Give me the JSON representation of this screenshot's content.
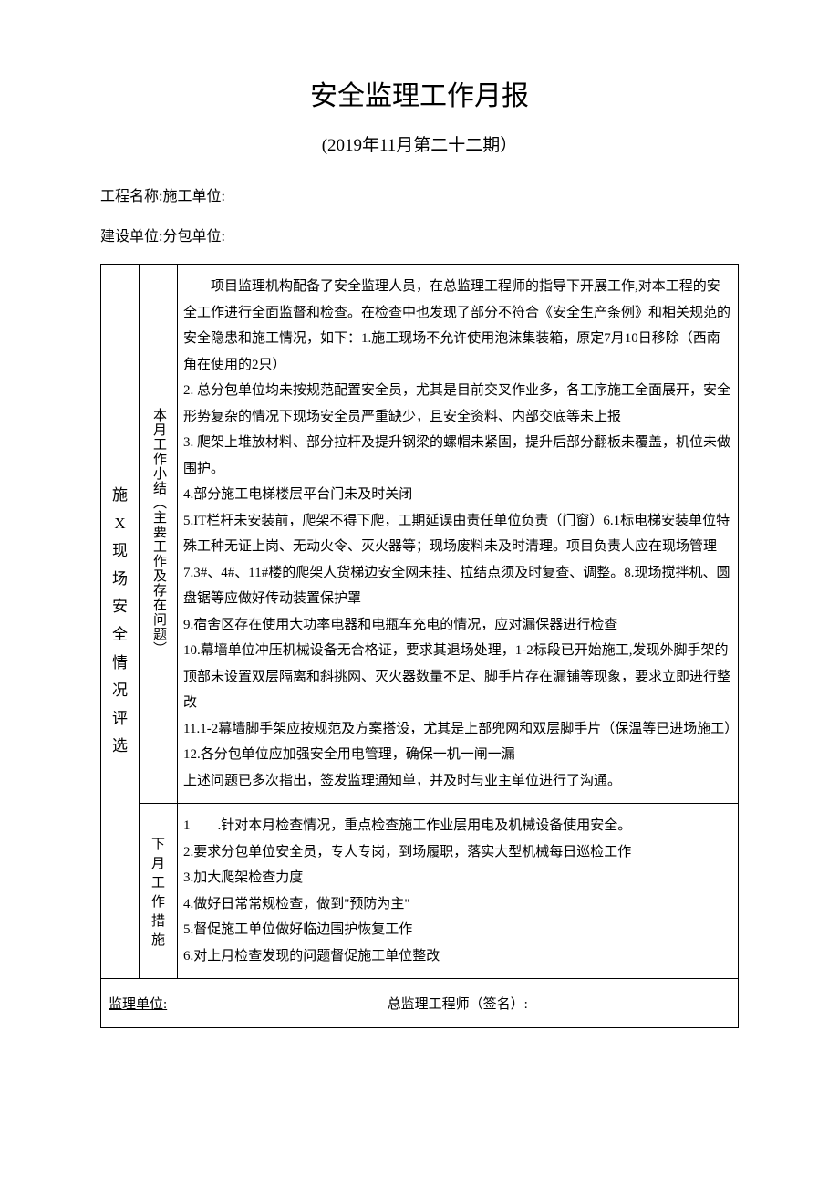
{
  "title": "安全监理工作月报",
  "subtitle": "(2019年11月第二十二期）",
  "meta": {
    "line1": "工程名称:施工单位:",
    "line2": "建设单位:分包单位:"
  },
  "rowLabel": "施X现 场安 全情 况评 选",
  "summary": {
    "label": "本月工作小结︵主要工作及存在问题︶",
    "intro": "项目监理机构配备了安全监理人员，在总监理工程师的指导下开展工作,对本工程的安全工作进行全面监督和检查。在检查中也发现了部分不符合《安全生产条例》和相关规范的安全隐患和施工情况，如下：1.施工现场不允许使用泡沫集装箱，原定7月10日移除（西南角在使用的2只）",
    "items": [
      "2. 总分包单位均未按规范配置安全员，尤其是目前交叉作业多，各工序施工全面展开，安全形势复杂的情况下现场安全员严重缺少，且安全资料、内部交底等未上报",
      "3. 爬架上堆放材料、部分拉杆及提升钢梁的螺帽未紧固，提升后部分翻板未覆盖，机位未做围护。",
      "4.部分施工电梯楼层平台门未及时关闭",
      "5.IT栏杆未安装前，爬架不得下爬，工期延误由责任单位负责（门窗）6.1标电梯安装单位特殊工种无证上岗、无动火令、灭火器等；现场废料未及时清理。项目负责人应在现场管理",
      "7.3#、4#、11#楼的爬架人货梯边安全网未挂、拉结点须及时复查、调整。8.现场搅拌机、圆盘锯等应做好传动装置保护罩",
      "9.宿舍区存在使用大功率电器和电瓶车充电的情况，应对漏保器进行检查",
      "10.幕墙单位冲压机械设备无合格证，要求其退场处理，1-2标段已开始施工,发现外脚手架的顶部未设置双层隔离和斜挑网、灭火器数量不足、脚手片存在漏铺等现象，要求立即进行整改",
      "11.1-2幕墙脚手架应按规范及方案搭设，尤其是上部兜网和双层脚手片（保温等已进场施工）",
      "12.各分包单位应加强安全用电管理，确保一机一闸一漏",
      "上述问题已多次指出，签发监理通知单，并及时与业主单位进行了沟通。"
    ]
  },
  "nextMonth": {
    "label": "下月 工作 措施",
    "items": [
      "1　　.针对本月检查情况，重点检查施工作业层用电及机械设备使用安全。",
      "2.要求分包单位安全员，专人专岗，到场履职，落实大型机械每日巡检工作",
      "3.加大爬架检查力度",
      "4.做好日常常规检查，做到\"预防为主\"",
      "5.督促施工单位做好临边围护恢复工作",
      "6.对上月检查发现的问题督促施工单位整改"
    ]
  },
  "footer": {
    "left": "监理单位:",
    "right": "总监理工程师（签名）:"
  }
}
